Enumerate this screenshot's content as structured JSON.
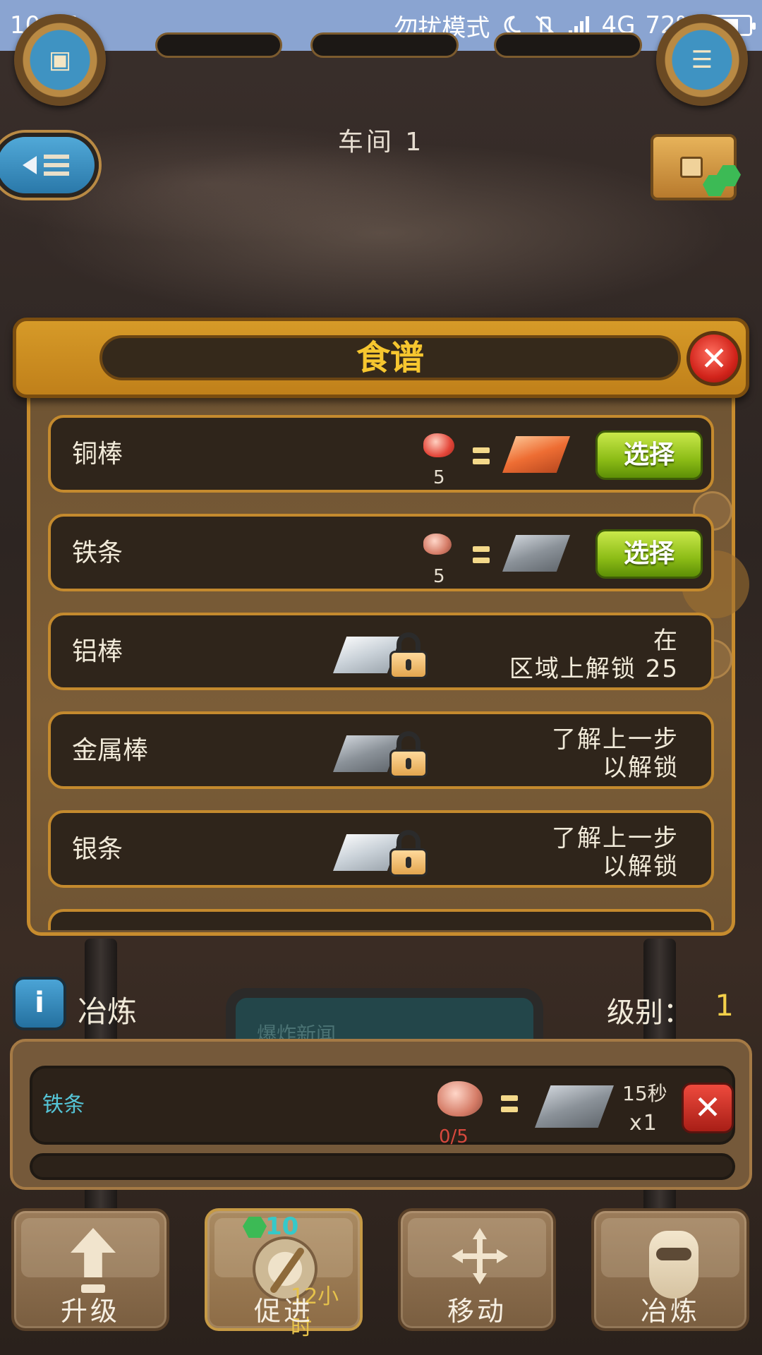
{
  "status_bar": {
    "time": "10:05",
    "dnd_mode": "勿扰模式",
    "network": "4G",
    "battery": "72%",
    "battery_level": 0.72
  },
  "hud": {
    "workshop_title": "车间 1",
    "left_icon": "briefcase-icon",
    "right_icon": "clipboard-icon"
  },
  "recipe_dialog": {
    "title": "食谱",
    "items": [
      {
        "name": "铜棒",
        "ore": "copper",
        "ore_count": "5",
        "product": "copper",
        "state": "available",
        "button_label": "选择"
      },
      {
        "name": "铁条",
        "ore": "iron",
        "ore_count": "5",
        "product": "iron",
        "state": "available",
        "button_label": "选择"
      },
      {
        "name": "铝棒",
        "product": "silver",
        "state": "locked",
        "unlock_line1": "在",
        "unlock_line2": "区域上解锁 25"
      },
      {
        "name": "金属棒",
        "product": "iron",
        "state": "locked",
        "unlock_line1": "了解上一步",
        "unlock_line2": "以解锁"
      },
      {
        "name": "银条",
        "product": "silver",
        "state": "locked",
        "unlock_line1": "了解上一步",
        "unlock_line2": "以解锁"
      }
    ]
  },
  "smelter": {
    "section_label": "冶炼",
    "level_label": "级别：",
    "level_value": "1",
    "background_screen_text": "爆炸新闻",
    "queue": {
      "name": "铁条",
      "ore_progress": "0/5",
      "duration": "15秒",
      "multiplier": "x1",
      "progress": 0.0
    }
  },
  "toolbar": {
    "upgrade_label": "升级",
    "boost_label": "促进",
    "boost_cost": "10",
    "boost_time": "12小时",
    "move_label": "移动",
    "smelt_label": "冶炼"
  },
  "colors": {
    "dialog_gold": "#d69a28",
    "select_green": "#8cbc16",
    "title_yellow": "#f6c62f",
    "queue_name_cyan": "#55c4d6",
    "ore_count_red": "#d8493d"
  }
}
